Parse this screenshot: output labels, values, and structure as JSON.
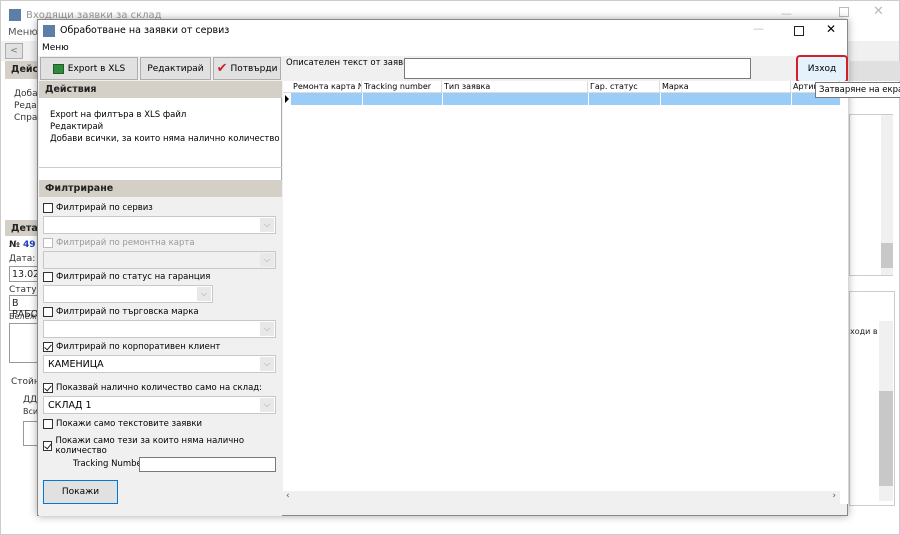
{
  "background_window": {
    "title": "Входящи заявки за склад",
    "menu": "Меню",
    "back_button": "<",
    "actions_header": "Дейст",
    "actions": [
      "Добав",
      "Редакт",
      "Справ"
    ],
    "details_header": "Детай",
    "number_label": "№",
    "number_value": "49",
    "date_label": "Дата:",
    "date_value": "13.02.",
    "status_label": "Статус:",
    "status_value": "В РАБО",
    "notes_label": "Бележка",
    "value_label": "Стойно",
    "vat_label": "ДДС",
    "all_label": "Всич",
    "grid_header_partial": "ходи в"
  },
  "window": {
    "title": "Обработване на заявки от сервиз",
    "menu": "Меню"
  },
  "toolbar": {
    "export_label": "Export в XLS",
    "edit_label": "Редактирай",
    "confirm_label": "Потвърди",
    "description_label": "Описателен текст от заявката:",
    "description_value": "",
    "exit_label": "Изход",
    "exit_tooltip": "Затваряне на екрана"
  },
  "actions": {
    "header": "Действия",
    "items": [
      "Export на филтъра в XLS файл",
      "Редактирай",
      "Добави всички, за които няма налично количество"
    ]
  },
  "filters": {
    "header": "Филтриране",
    "service": {
      "label": "Филтрирай по сервиз",
      "checked": false,
      "value": ""
    },
    "repair_card": {
      "label": "Филтрирай по ремонтна карта",
      "checked": false,
      "disabled": true,
      "value": ""
    },
    "warranty": {
      "label": "Филтрирай по статус на гаранция",
      "checked": false,
      "value": ""
    },
    "brand": {
      "label": "Филтрирай по търговска марка",
      "checked": false,
      "value": ""
    },
    "corporate": {
      "label": "Филтрирай по корпоративен клиент",
      "checked": true,
      "value": "КАМЕНИЦА"
    },
    "warehouse": {
      "label": "Показвай налично количество само на склад:",
      "checked": true,
      "value": "СКЛАД 1"
    },
    "text_only": {
      "label": "Покажи само текстовите заявки",
      "checked": false
    },
    "no_stock": {
      "label": "Покажи само тези за които няма налично количество",
      "checked": true
    },
    "tracking_label": "Tracking Number:",
    "tracking_value": "",
    "show_button": "Покажи"
  },
  "grid": {
    "columns": [
      "Ремонта карта №",
      "Tracking number",
      "Тип заявка",
      "Гар. статус",
      "Марка",
      "Артик"
    ],
    "rows": [
      [
        "",
        "",
        "",
        "",
        "",
        ""
      ]
    ],
    "selected_row_color": "#99ccf6"
  },
  "colors": {
    "accent_red": "#d0202a",
    "selection": "#99ccf6"
  }
}
